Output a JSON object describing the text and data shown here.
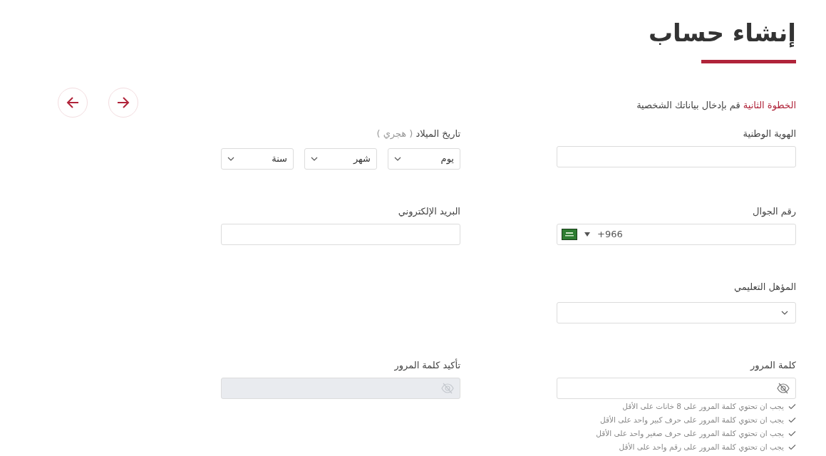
{
  "title": "إنشاء حساب",
  "step": {
    "label": "الخطوة الثانية",
    "text": "قم بإدخال بياناتك الشخصية"
  },
  "nav_buttons": [
    {
      "kind": "back"
    },
    {
      "kind": "forward"
    }
  ],
  "rows": [
    [
      {
        "kind": "text",
        "label": "الهوية الوطنية"
      },
      {
        "kind": "date",
        "label": "تاريخ الميلاد",
        "label_note": "( هجري )",
        "selects": [
          {
            "placeholder": "يوم"
          },
          {
            "placeholder": "شهر"
          },
          {
            "placeholder": "سنة"
          }
        ]
      }
    ],
    [
      {
        "kind": "phone",
        "label": "رقم الجوال",
        "value": "+966"
      },
      {
        "kind": "text",
        "label": "البريد الإلكتروني"
      }
    ],
    [
      {
        "kind": "select",
        "label": "المؤهل التعليمي"
      }
    ],
    [
      {
        "kind": "password",
        "label": "كلمة المرور",
        "disabled": false,
        "rules": [
          "يجب ان تحتوي كلمة المرور على 8 خانات على الأقل",
          "يجب ان تحتوي كلمة المرور على حرف كبير واحد على الأقل",
          "يجب ان تحتوي كلمة المرور على حرف صغير واحد على الأقل",
          "يجب ان تحتوي كلمة المرور على رقم واحد على الأقل"
        ]
      },
      {
        "kind": "password",
        "label": "تأكيد كلمة المرور",
        "disabled": true
      }
    ]
  ]
}
